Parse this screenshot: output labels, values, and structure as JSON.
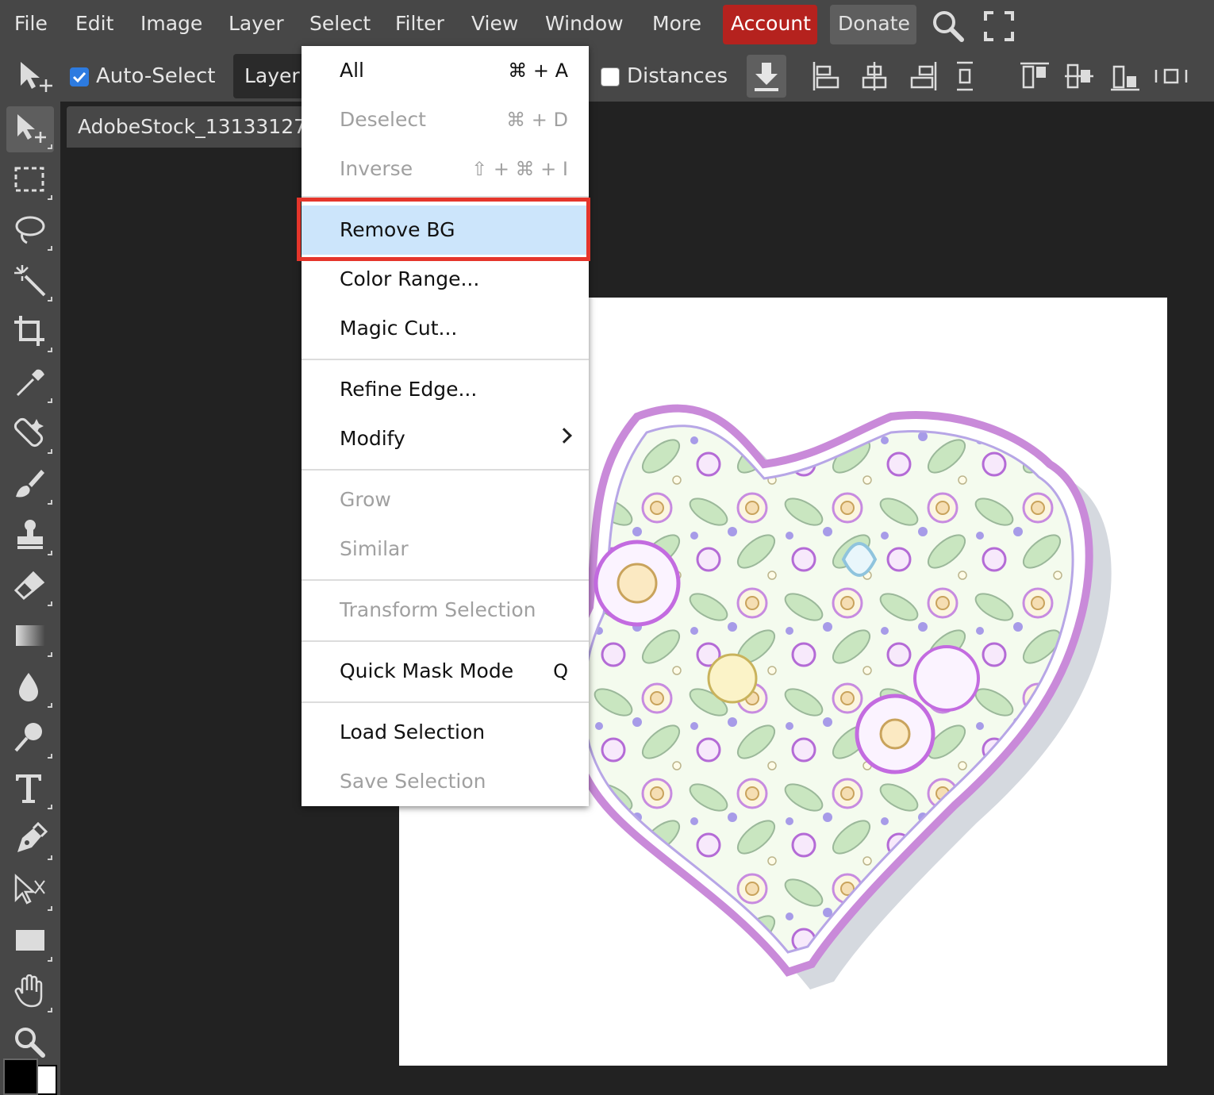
{
  "menubar": {
    "items": [
      "File",
      "Edit",
      "Image",
      "Layer",
      "Select",
      "Filter",
      "View",
      "Window",
      "More"
    ],
    "account": "Account",
    "donate": "Donate",
    "account_color": "#b5221e"
  },
  "options": {
    "auto_select_label": "Auto-Select",
    "auto_select_checked": true,
    "layer_select": "Layer",
    "distances_label": "Distances",
    "distances_checked": false
  },
  "document": {
    "tab_title": "AdobeStock_13133127"
  },
  "select_menu": {
    "items": [
      {
        "label": "All",
        "shortcut": "⌘ + A",
        "enabled": true
      },
      {
        "label": "Deselect",
        "shortcut": "⌘ + D",
        "enabled": false
      },
      {
        "label": "Inverse",
        "shortcut": "⇧ + ⌘ + I",
        "enabled": false
      },
      {
        "label": "Remove BG",
        "shortcut": "",
        "enabled": true,
        "highlighted": true
      },
      {
        "label": "Color Range...",
        "shortcut": "",
        "enabled": true
      },
      {
        "label": "Magic Cut...",
        "shortcut": "",
        "enabled": true
      },
      {
        "label": "Refine Edge...",
        "shortcut": "",
        "enabled": true
      },
      {
        "label": "Modify",
        "shortcut": "",
        "enabled": true,
        "submenu": true
      },
      {
        "label": "Grow",
        "shortcut": "",
        "enabled": false
      },
      {
        "label": "Similar",
        "shortcut": "",
        "enabled": false
      },
      {
        "label": "Transform Selection",
        "shortcut": "",
        "enabled": false
      },
      {
        "label": "Quick Mask Mode",
        "shortcut": "Q",
        "enabled": true
      },
      {
        "label": "Load Selection",
        "shortcut": "",
        "enabled": true
      },
      {
        "label": "Save Selection",
        "shortcut": "",
        "enabled": false
      }
    ],
    "highlight_color": "#cce5fb",
    "callout_color": "#e5352b"
  },
  "tools": [
    "move-tool",
    "marquee-tool",
    "lasso-tool",
    "magic-wand-tool",
    "crop-tool",
    "eyedropper-tool",
    "healing-tool",
    "brush-tool",
    "stamp-tool",
    "eraser-tool",
    "gradient-tool",
    "blur-tool",
    "dodge-tool",
    "type-tool",
    "pen-tool",
    "path-select-tool",
    "shape-tool",
    "hand-tool",
    "zoom-tool"
  ],
  "colors": {
    "foreground": "#000000",
    "background": "#ffffff"
  }
}
